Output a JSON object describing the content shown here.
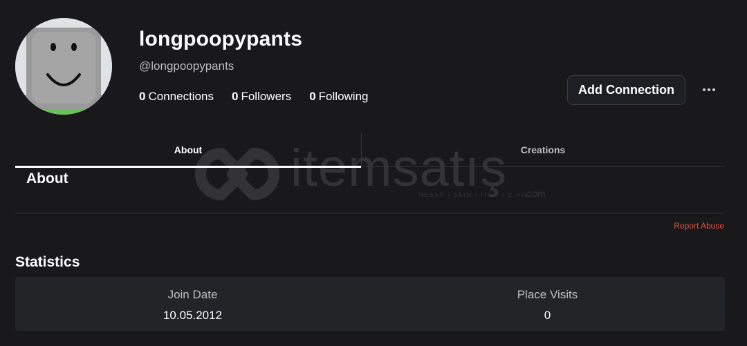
{
  "profile": {
    "display_name": "longpoopypants",
    "handle": "@longpoopypants",
    "connections_count": "0",
    "connections_label": "Connections",
    "followers_count": "0",
    "followers_label": "Followers",
    "following_count": "0",
    "following_label": "Following"
  },
  "actions": {
    "add_connection_label": "Add Connection",
    "more_icon": "more-horizontal-icon"
  },
  "tabs": [
    {
      "label": "About",
      "active": true
    },
    {
      "label": "Creations",
      "active": false
    }
  ],
  "about": {
    "heading": "About",
    "report_label": "Report Abuse"
  },
  "statistics": {
    "heading": "Statistics",
    "items": [
      {
        "label": "Join Date",
        "value": "10.05.2012"
      },
      {
        "label": "Place Visits",
        "value": "0"
      }
    ]
  },
  "watermark": {
    "text": "itemsatış",
    "subtext": "HESAP / SKIN / ITEM / E-PIN",
    "suffix": ".com"
  },
  "colors": {
    "background": "#19191c",
    "panel": "#232428",
    "report_link": "#e0513e",
    "muted_text": "#bdbec1"
  }
}
